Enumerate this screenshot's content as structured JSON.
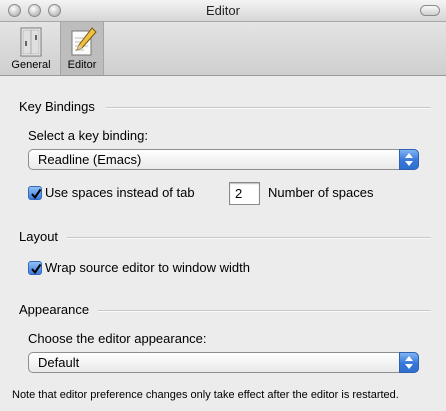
{
  "window": {
    "title": "Editor"
  },
  "toolbar": {
    "items": [
      {
        "label": "General",
        "icon": "general-prefs-icon"
      },
      {
        "label": "Editor",
        "icon": "pencil-notepad-icon",
        "selected": true
      }
    ]
  },
  "key_bindings": {
    "section_label": "Key Bindings",
    "select_label": "Select a key binding:",
    "selected": "Readline (Emacs)",
    "use_spaces": {
      "label": "Use spaces instead of tab",
      "checked": true
    },
    "spaces_value": "2",
    "spaces_label": "Number of spaces"
  },
  "layout": {
    "section_label": "Layout",
    "wrap": {
      "label": "Wrap source editor to window width",
      "checked": true
    }
  },
  "appearance": {
    "section_label": "Appearance",
    "choose_label": "Choose the editor appearance:",
    "selected": "Default"
  },
  "note": "Note that editor preference changes only take effect after the editor is restarted.",
  "colors": {
    "accent": "#3a7bdc",
    "window_bg": "#ececec"
  }
}
